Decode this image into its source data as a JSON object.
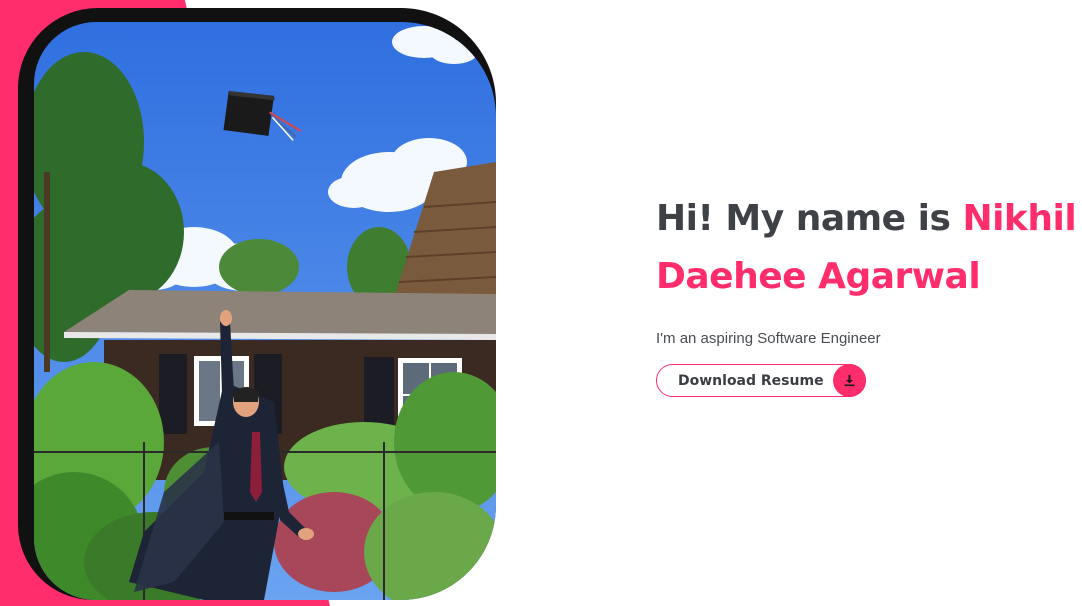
{
  "hero": {
    "greeting": "Hi! My name is ",
    "first_name": "Nikhil",
    "last_name": "Daehee Agarwal",
    "subtitle": "I'm an aspiring Software Engineer",
    "download_label": "Download Resume",
    "photo_alt": "Graduation photo throwing cap in the air"
  },
  "colors": {
    "accent": "#ff2d6b",
    "text_dark": "#3e4146"
  },
  "icons": {
    "download": "download-icon"
  }
}
